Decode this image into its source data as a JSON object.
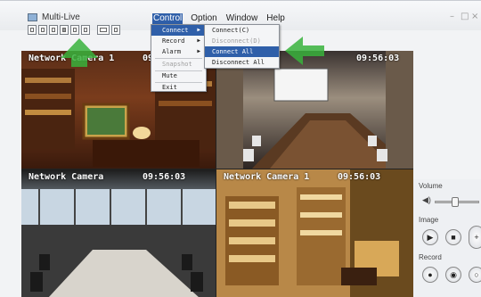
{
  "window": {
    "title": "Multi-Live",
    "controls": [
      "–",
      "□",
      "×"
    ]
  },
  "menubar": {
    "items": [
      {
        "label": "Control",
        "active": true
      },
      {
        "label": "Option",
        "active": false
      },
      {
        "label": "Window",
        "active": false
      },
      {
        "label": "Help",
        "active": false
      }
    ]
  },
  "control_menu": {
    "items": [
      {
        "label": "Connect",
        "submenu": true,
        "selected": true,
        "disabled": false
      },
      {
        "label": "Record",
        "submenu": true,
        "selected": false,
        "disabled": false
      },
      {
        "label": "Alarm",
        "submenu": true,
        "selected": false,
        "disabled": false
      },
      {
        "label": "Snapshot",
        "submenu": false,
        "selected": false,
        "disabled": true
      },
      {
        "label": "Mute",
        "submenu": false,
        "selected": false,
        "disabled": false
      },
      {
        "label": "Exit",
        "submenu": false,
        "selected": false,
        "disabled": false
      }
    ]
  },
  "connect_submenu": {
    "items": [
      {
        "label": "Connect(C)",
        "selected": false,
        "disabled": false
      },
      {
        "label": "Disconnect(D)",
        "selected": false,
        "disabled": true
      },
      {
        "label": "Connect All",
        "selected": true,
        "disabled": false
      },
      {
        "label": "Disconnect All",
        "selected": false,
        "disabled": false
      }
    ]
  },
  "cameras": [
    {
      "label": "Network Camera 1",
      "time": "09:56:03"
    },
    {
      "label": "",
      "time": "09:56:03"
    },
    {
      "label": "Network Camera",
      "time": "09:56:03"
    },
    {
      "label": "Network Camera 1",
      "time": "09:56:03"
    }
  ],
  "right_panel": {
    "volume_label": "Volume",
    "volume_level": 0.45,
    "image_label": "Image",
    "record_label": "Record"
  },
  "colors": {
    "highlight": "#2f5fa9",
    "arrow": "#38b23c"
  },
  "icons": [
    "app-icon",
    "play-icon",
    "stop-icon",
    "record-icon",
    "speaker-icon"
  ]
}
